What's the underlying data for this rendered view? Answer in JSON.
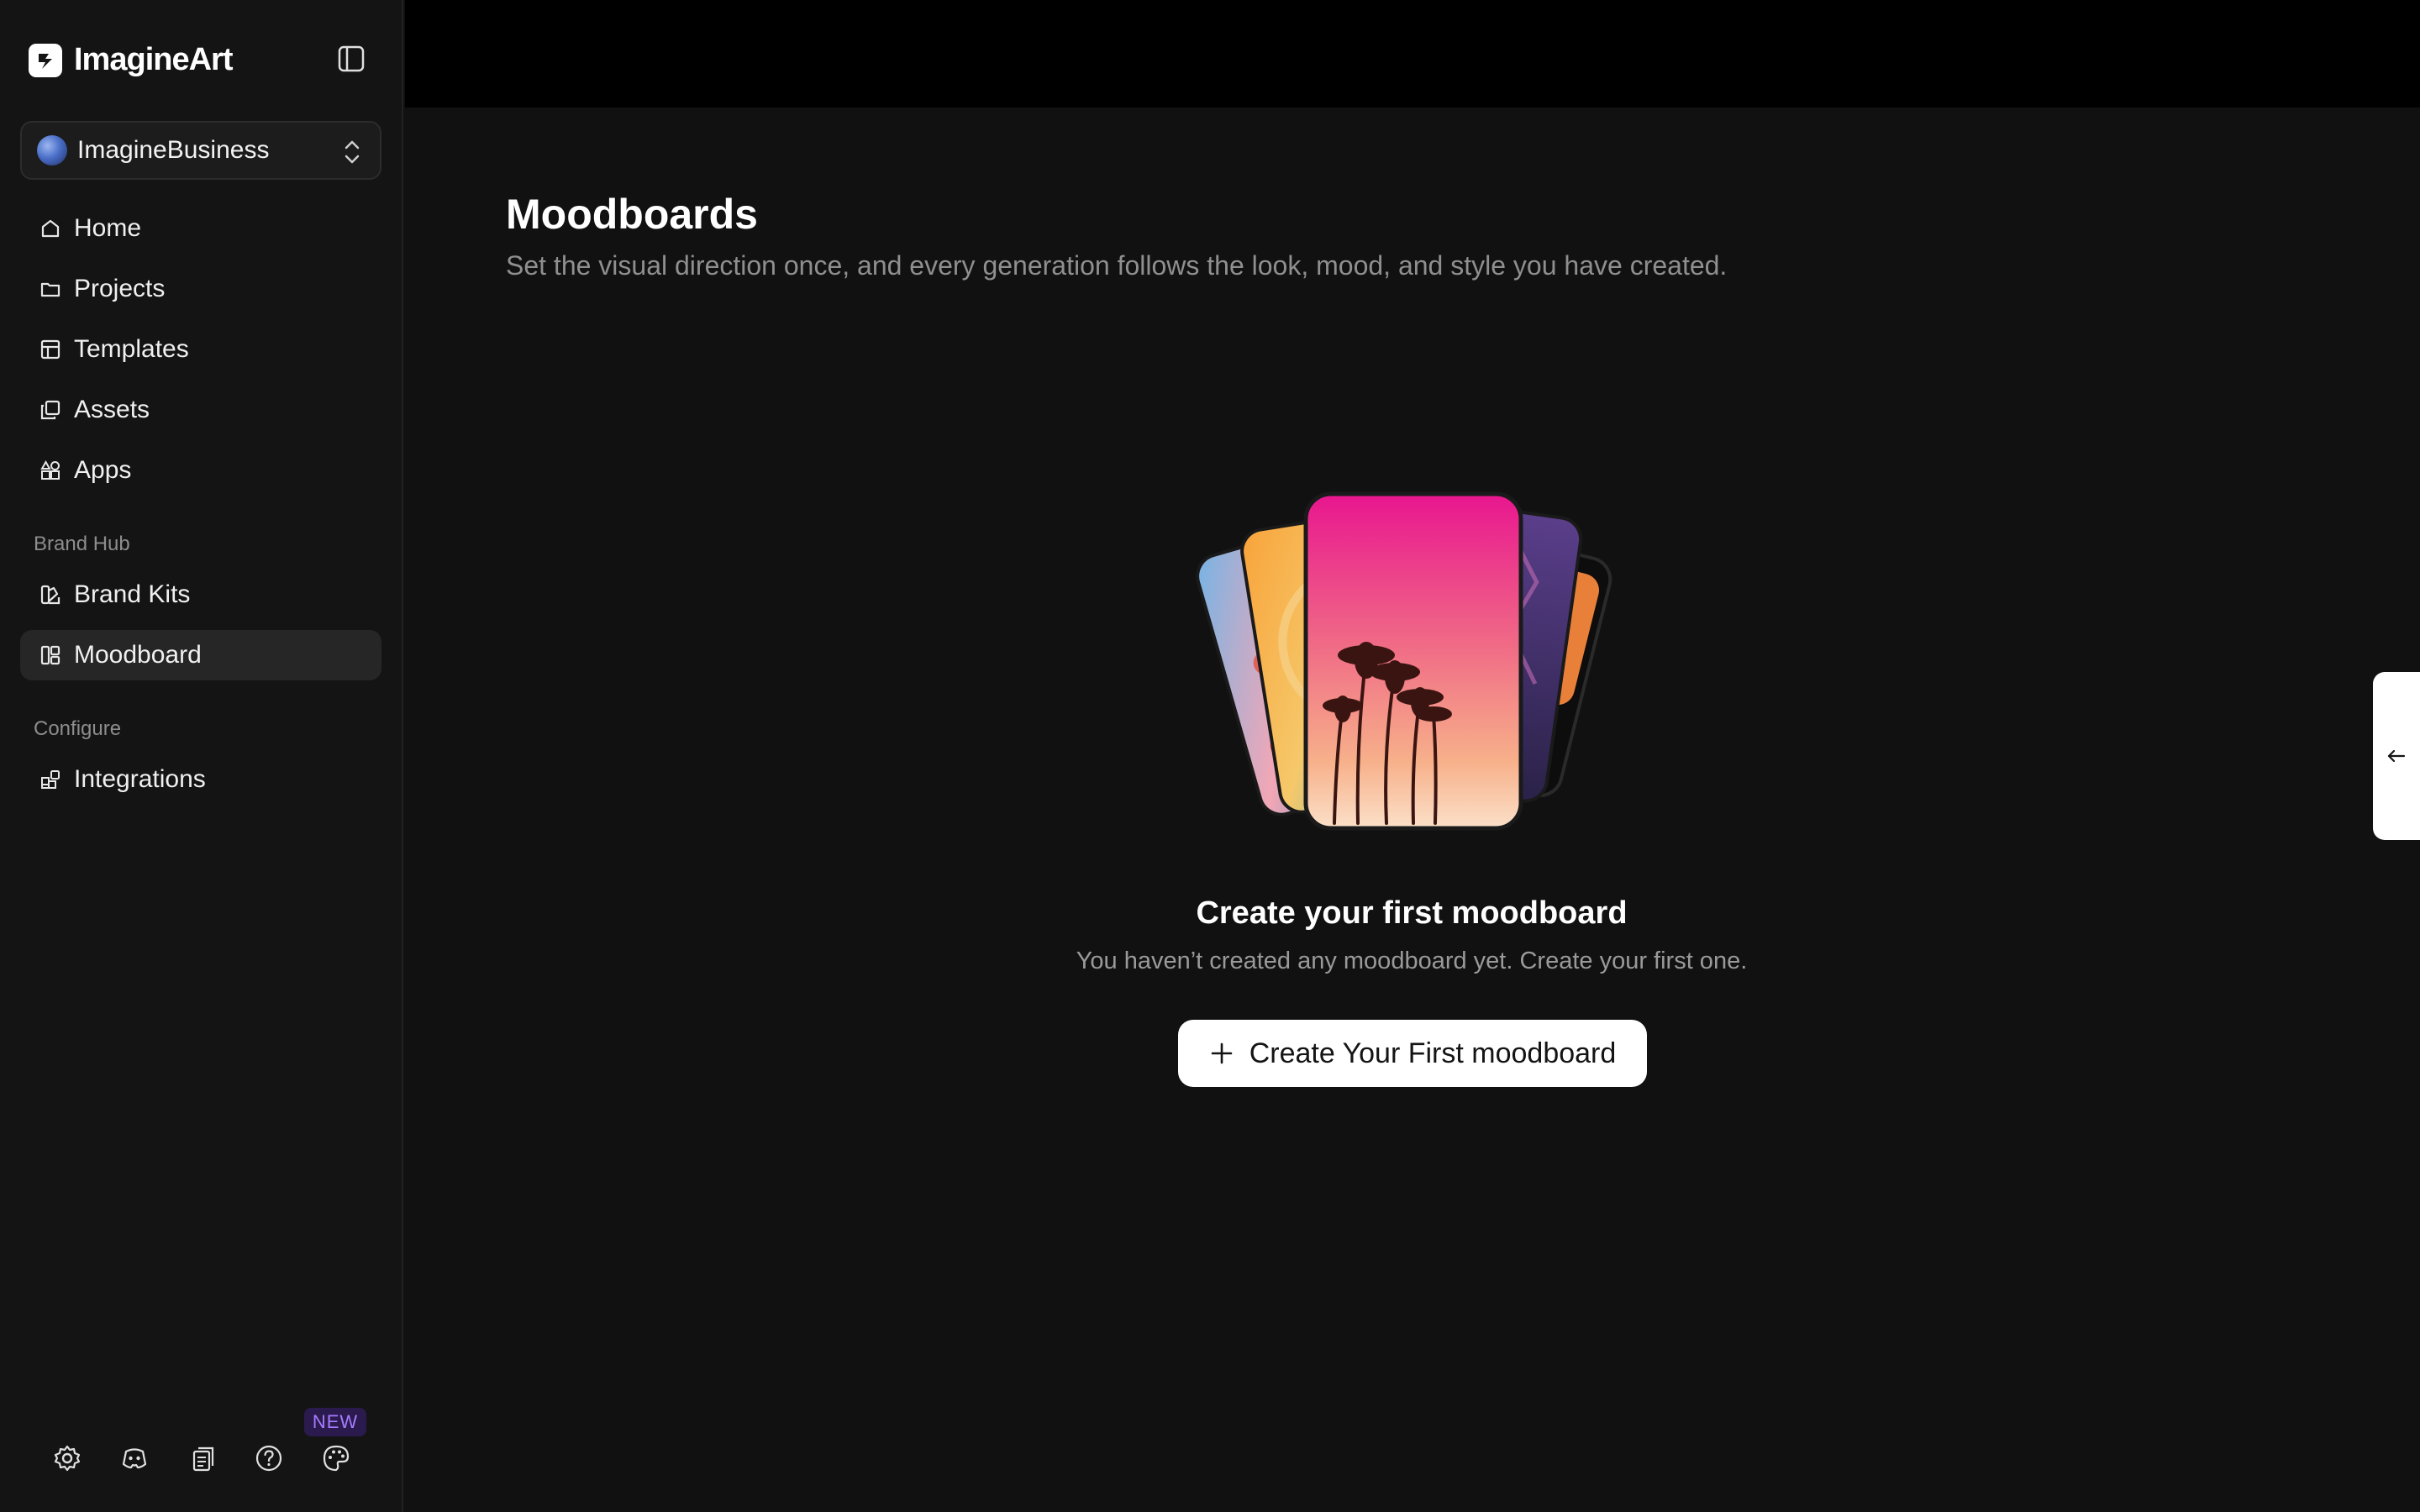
{
  "app": {
    "name": "ImagineArt"
  },
  "workspace": {
    "name": "ImagineBusiness"
  },
  "nav": {
    "home": "Home",
    "projects": "Projects",
    "templates": "Templates",
    "assets": "Assets",
    "apps": "Apps",
    "brand_hub_label": "Brand Hub",
    "brand_kits": "Brand Kits",
    "moodboard": "Moodboard",
    "configure_label": "Configure",
    "integrations": "Integrations"
  },
  "bottom": {
    "new_badge": "NEW"
  },
  "main": {
    "title": "Moodboards",
    "subtitle": "Set the visual direction once, and every generation follows the look, mood, and style you have created.",
    "empty_title": "Create your first moodboard",
    "empty_subtitle": "You haven’t created any moodboard yet. Create your first one.",
    "create_button": "Create Your First moodboard"
  },
  "colors": {
    "background": "#111111",
    "sidebar": "#141414",
    "topbar": "#000000",
    "accent_badge": "#a77bff"
  }
}
